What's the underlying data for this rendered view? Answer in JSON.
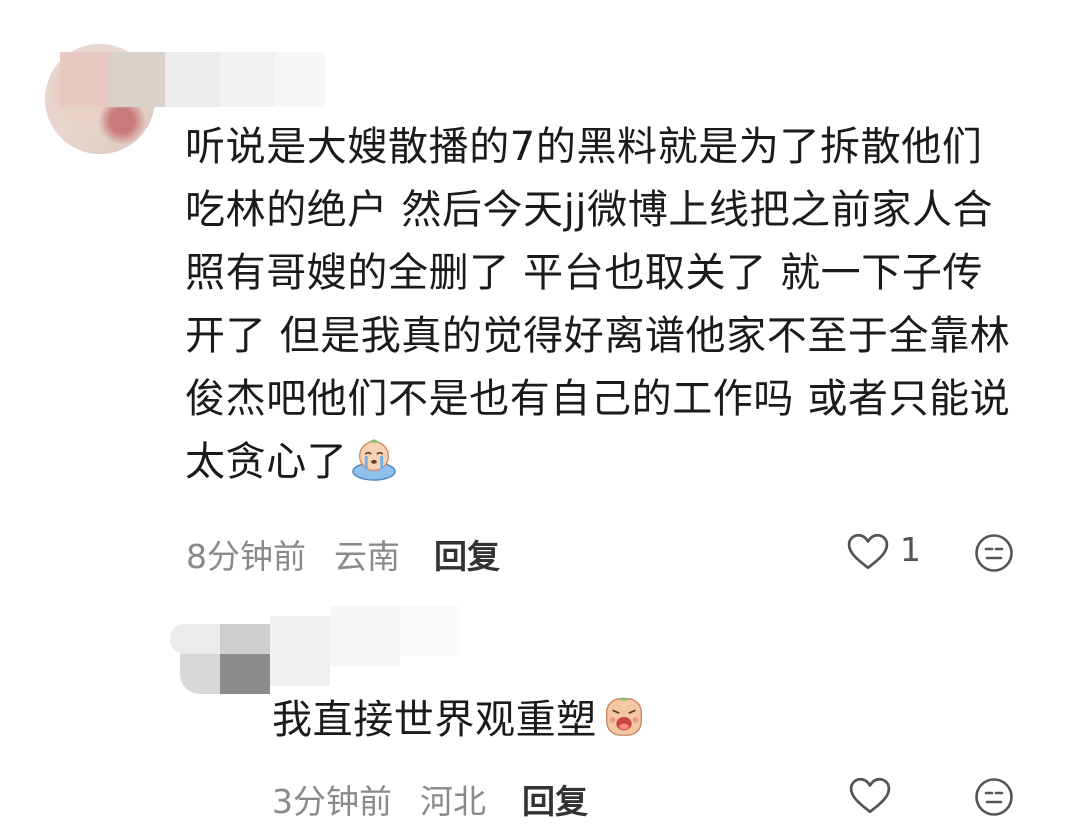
{
  "comments": [
    {
      "text_lines": [
        "听说是大嫂散播的7的黑料就是为了拆散他们",
        "吃林的绝户 然后今天jj微博上线把之前家人合",
        "照有哥嫂的全删了 平台也取关了 就一下子传",
        "开了 但是我真的觉得好离谱他家不至于全靠林",
        "俊杰吧他们不是也有自己的工作吗 或者只能说",
        "太贪心了"
      ],
      "emoji": "crying-face-emoji",
      "time": "8分钟前",
      "location": "云南",
      "reply_label": "回复",
      "like_count": "1"
    },
    {
      "text_lines": [
        "我直接世界观重塑"
      ],
      "emoji": "wailing-face-emoji",
      "time": "3分钟前",
      "location": "河北",
      "reply_label": "回复",
      "like_count": ""
    }
  ],
  "icons": {
    "like": "heart-outline-icon",
    "react": "emoji-face-icon"
  },
  "colors": {
    "text": "#1b1b1b",
    "meta": "#8a8a8a",
    "icon": "#555555",
    "emoji_skin": "#f5c9a8",
    "emoji_blue": "#7fb2e6"
  }
}
